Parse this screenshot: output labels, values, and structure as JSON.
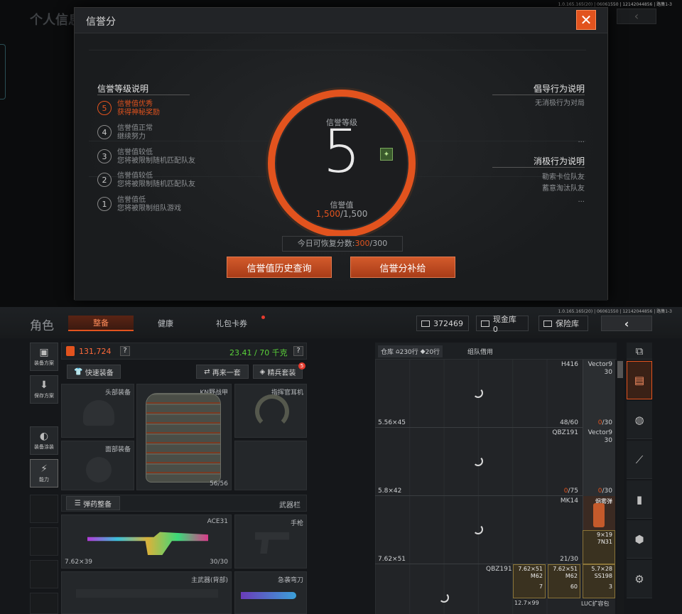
{
  "bg_top": {
    "title": "个人信息",
    "version": "1.0.165.165(20) | 06061550 | 12142044856 | 路集1-3"
  },
  "modal": {
    "title": "信誉分",
    "close_icon": "close-icon",
    "left_section_title": "信誉等级说明",
    "levels": [
      {
        "num": "5",
        "line1": "信誉值优秀",
        "line2": "获得神秘奖励"
      },
      {
        "num": "4",
        "line1": "信誉值正常",
        "line2": "继续努力"
      },
      {
        "num": "3",
        "line1": "信誉值较低",
        "line2": "您将被限制随机匹配队友"
      },
      {
        "num": "2",
        "line1": "信誉值较低",
        "line2": "您将被限制随机匹配队友"
      },
      {
        "num": "1",
        "line1": "信誉值低",
        "line2": "您将被限制组队游戏"
      }
    ],
    "level_label": "信誉等级",
    "level_value": "5",
    "score_label": "信誉值",
    "score_current": "1,500",
    "score_max": "/1,500",
    "right_title1": "倡导行为说明",
    "right_items1": [
      "无消极行为对局",
      "..."
    ],
    "right_title2": "消极行为说明",
    "right_items2": [
      "勒索卡位队友",
      "蓄意淘汰队友",
      "..."
    ],
    "recover_label": "今日可恢复分数:",
    "recover_value": "300",
    "recover_max": "/300",
    "btn_history": "信誉值历史查询",
    "btn_supply": "信誉分补给",
    "accent": "#e2531e"
  },
  "nav": {
    "title": "角色",
    "tabs": [
      "整备",
      "健康",
      "礼包卡券"
    ],
    "currency": "372469",
    "cash_label": "现金库 0",
    "safe_label": "保险库",
    "back_icon": "chevron-left-icon",
    "version": "1.0.165.165(20) | 06061550 | 12142044856 | 路集1-3"
  },
  "rail": [
    {
      "icon": "vest-icon",
      "label": "装备方案"
    },
    {
      "icon": "save-icon",
      "label": "保存方案"
    },
    {
      "icon": "helmet-icon",
      "label": "装备涂装"
    },
    {
      "icon": "power-icon",
      "label": "能力"
    }
  ],
  "gear": {
    "value": "131,724",
    "weight": "23.41 / 70 千克",
    "help": "?",
    "quick_equip": "快速装备",
    "again": "再来一套",
    "elite": "精兵套装",
    "elite_badge": "5",
    "slots": {
      "head": "头部装备",
      "vest": "KN野战甲",
      "vest_count": "56/56",
      "headset": "指挥官耳机",
      "face": "面部装备"
    },
    "ammo_btn": "弹药整备",
    "weapon_bar": "武器栏",
    "primary": "ACE31",
    "primary_cal": "7.62×39",
    "primary_count": "30/30",
    "pistol": "手枪",
    "back_weapon": "主武器(背部)",
    "melee": "急袭弯刀"
  },
  "warehouse": {
    "tab": "仓库",
    "rows_label": "230行",
    "rows2_label": "20行",
    "team_tab": "组队借用",
    "rows": [
      {
        "name": "H416",
        "cal": "5.56×45",
        "count": "48/60",
        "side": "Vector9",
        "side_num": "30",
        "side_red": "0",
        "side_max": "/30"
      },
      {
        "name": "QBZ191",
        "cal": "5.8×42",
        "count_red": "0",
        "count": "/75",
        "side": "Vector9",
        "side_num": "30",
        "side_red": "0",
        "side_max": "/30"
      },
      {
        "name": "MK14",
        "cal": "7.62×51",
        "count": "21/30",
        "side": "烟雾弹",
        "ammo": "9×19",
        "ammo_sub": "7N31"
      },
      {
        "name": "QBZ191",
        "cal": "",
        "count": ""
      }
    ],
    "ammo_row4": [
      {
        "cal": "7.62×51",
        "sub": "M62",
        "n": "7"
      },
      {
        "cal": "7.62×51",
        "sub": "M62",
        "n": "60"
      },
      {
        "cal": "5.7×28",
        "sub": "SS198",
        "n": "3"
      }
    ],
    "bottom_labels": [
      "12.7×99",
      "LUC扩容包"
    ]
  },
  "categories": [
    "all-items-icon",
    "box-icon",
    "backpack-icon",
    "rifle-icon",
    "magazine-icon",
    "grenade-icon",
    "gear-icon"
  ]
}
